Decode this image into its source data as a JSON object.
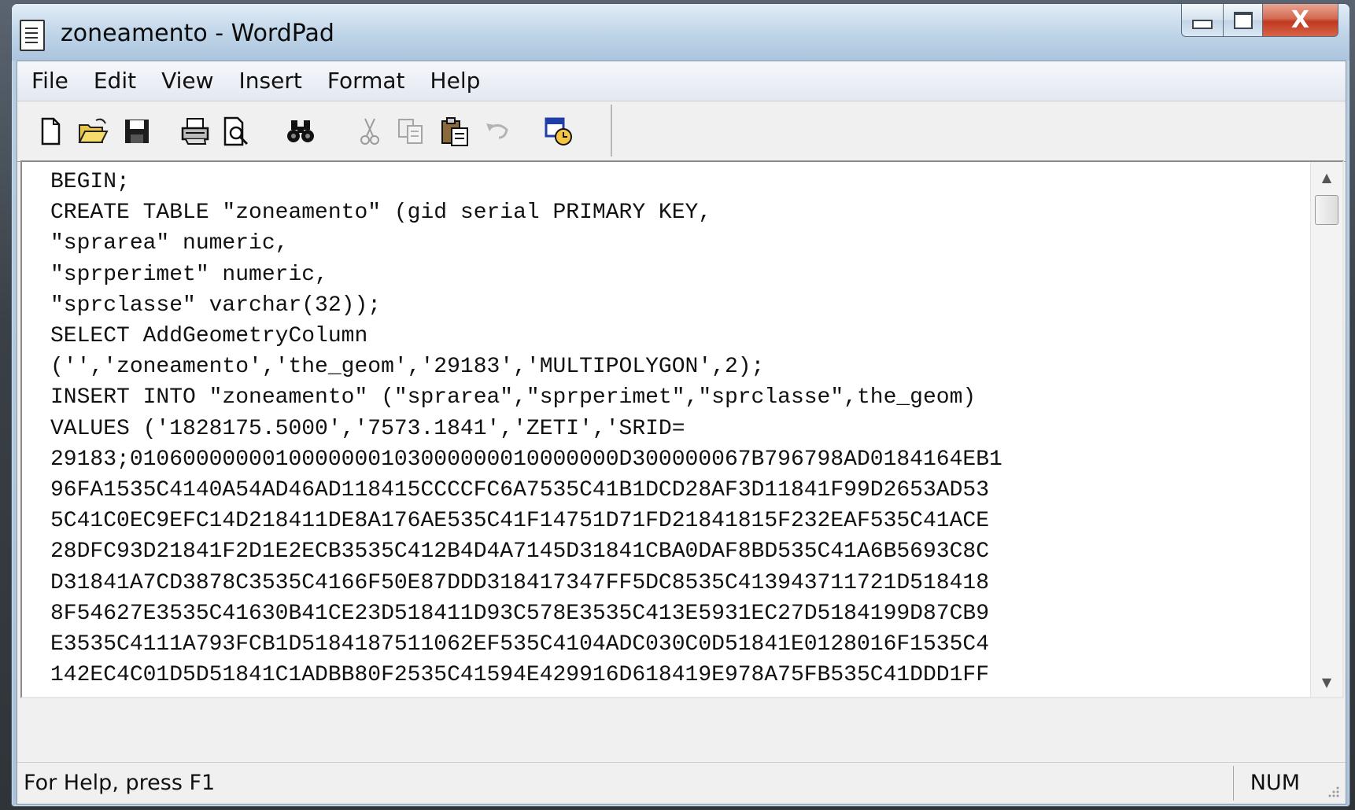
{
  "window": {
    "title": "zoneamento - WordPad",
    "close_glyph": "X"
  },
  "menu": {
    "items": [
      {
        "label": "File"
      },
      {
        "label": "Edit"
      },
      {
        "label": "View"
      },
      {
        "label": "Insert"
      },
      {
        "label": "Format"
      },
      {
        "label": "Help"
      }
    ]
  },
  "toolbar": {
    "icons": [
      "new-document-icon",
      "open-folder-icon",
      "save-icon",
      "print-icon",
      "print-preview-icon",
      "find-icon",
      "cut-icon",
      "copy-icon",
      "paste-icon",
      "undo-icon",
      "date-time-icon"
    ]
  },
  "document": {
    "lines": [
      "BEGIN;",
      "CREATE TABLE \"zoneamento\" (gid serial PRIMARY KEY,",
      "\"sprarea\" numeric,",
      "\"sprperimet\" numeric,",
      "\"sprclasse\" varchar(32));",
      "SELECT AddGeometryColumn",
      "('','zoneamento','the_geom','29183','MULTIPOLYGON',2);",
      "INSERT INTO \"zoneamento\" (\"sprarea\",\"sprperimet\",\"sprclasse\",the_geom)",
      "VALUES ('1828175.5000','7573.1841','ZETI','SRID=",
      "29183;0106000000010000000103000000010000000D300000067B796798AD0184164EB1",
      "96FA1535C4140A54AD46AD118415CCCCFC6A7535C41B1DCD28AF3D11841F99D2653AD53",
      "5C41C0EC9EFC14D218411DE8A176AE535C41F14751D71FD21841815F232EAF535C41ACE",
      "28DFC93D21841F2D1E2ECB3535C412B4D4A7145D31841CBA0DAF8BD535C41A6B5693C8C",
      "D31841A7CD3878C3535C4166F50E87DDD318417347FF5DC8535C413943711721D518418",
      "8F54627E3535C41630B41CE23D518411D93C578E3535C413E5931EC27D5184199D87CB9",
      "E3535C4111A793FCB1D5184187511062EF535C4104ADC030C0D51841E0128016F1535C4",
      "142EC4C01D5D51841C1ADBB80F2535C41594E429916D618419E978A75FB535C41DDD1FF"
    ]
  },
  "status": {
    "help_text": "For Help, press F1",
    "num_indicator": "NUM"
  },
  "scrollbar": {
    "up_glyph": "▲",
    "down_glyph": "▼"
  }
}
